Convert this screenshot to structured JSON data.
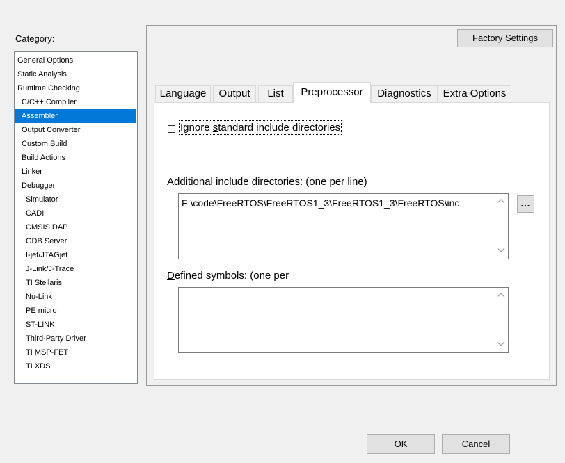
{
  "category": {
    "label": "Category:",
    "items": [
      {
        "label": "General Options",
        "indent": 0
      },
      {
        "label": "Static Analysis",
        "indent": 0
      },
      {
        "label": "Runtime Checking",
        "indent": 0
      },
      {
        "label": "C/C++ Compiler",
        "indent": 1
      },
      {
        "label": "Assembler",
        "indent": 1,
        "selected": true
      },
      {
        "label": "Output Converter",
        "indent": 1
      },
      {
        "label": "Custom Build",
        "indent": 1
      },
      {
        "label": "Build Actions",
        "indent": 1
      },
      {
        "label": "Linker",
        "indent": 1
      },
      {
        "label": "Debugger",
        "indent": 1
      },
      {
        "label": "Simulator",
        "indent": 2
      },
      {
        "label": "CADI",
        "indent": 2
      },
      {
        "label": "CMSIS DAP",
        "indent": 2
      },
      {
        "label": "GDB Server",
        "indent": 2
      },
      {
        "label": "I-jet/JTAGjet",
        "indent": 2
      },
      {
        "label": "J-Link/J-Trace",
        "indent": 2
      },
      {
        "label": "TI Stellaris",
        "indent": 2
      },
      {
        "label": "Nu-Link",
        "indent": 2
      },
      {
        "label": "PE micro",
        "indent": 2
      },
      {
        "label": "ST-LINK",
        "indent": 2
      },
      {
        "label": "Third-Party Driver",
        "indent": 2
      },
      {
        "label": "TI MSP-FET",
        "indent": 2
      },
      {
        "label": "TI XDS",
        "indent": 2
      }
    ]
  },
  "factory_settings_label": "Factory Settings",
  "tabs": [
    {
      "label": "Language"
    },
    {
      "label": "Output"
    },
    {
      "label": "List"
    },
    {
      "label": "Preprocessor",
      "active": true
    },
    {
      "label": "Diagnostics"
    },
    {
      "label": "Extra Options"
    }
  ],
  "preprocessor": {
    "ignore_std_include": {
      "label_prefix": "Ignore ",
      "label_accel": "s",
      "label_suffix": "tandard include directories",
      "checked": false
    },
    "additional_include": {
      "label_accel": "A",
      "label_rest": "dditional include directories:  (one per line)",
      "value": "F:\\code\\FreeRTOS\\FreeRTOS1_3\\FreeRTOS1_3\\FreeRTOS\\inc"
    },
    "defined_symbols": {
      "label_accel": "D",
      "label_rest": "efined symbols:  (one per",
      "value": ""
    },
    "ellipsis_label": "..."
  },
  "buttons": {
    "ok": "OK",
    "cancel": "Cancel"
  },
  "icons": {
    "scroll_up": "chevron-up-icon",
    "scroll_down": "chevron-down-icon"
  },
  "colors": {
    "selection": "#0078d7",
    "panel_bg": "#f0f0f0"
  }
}
